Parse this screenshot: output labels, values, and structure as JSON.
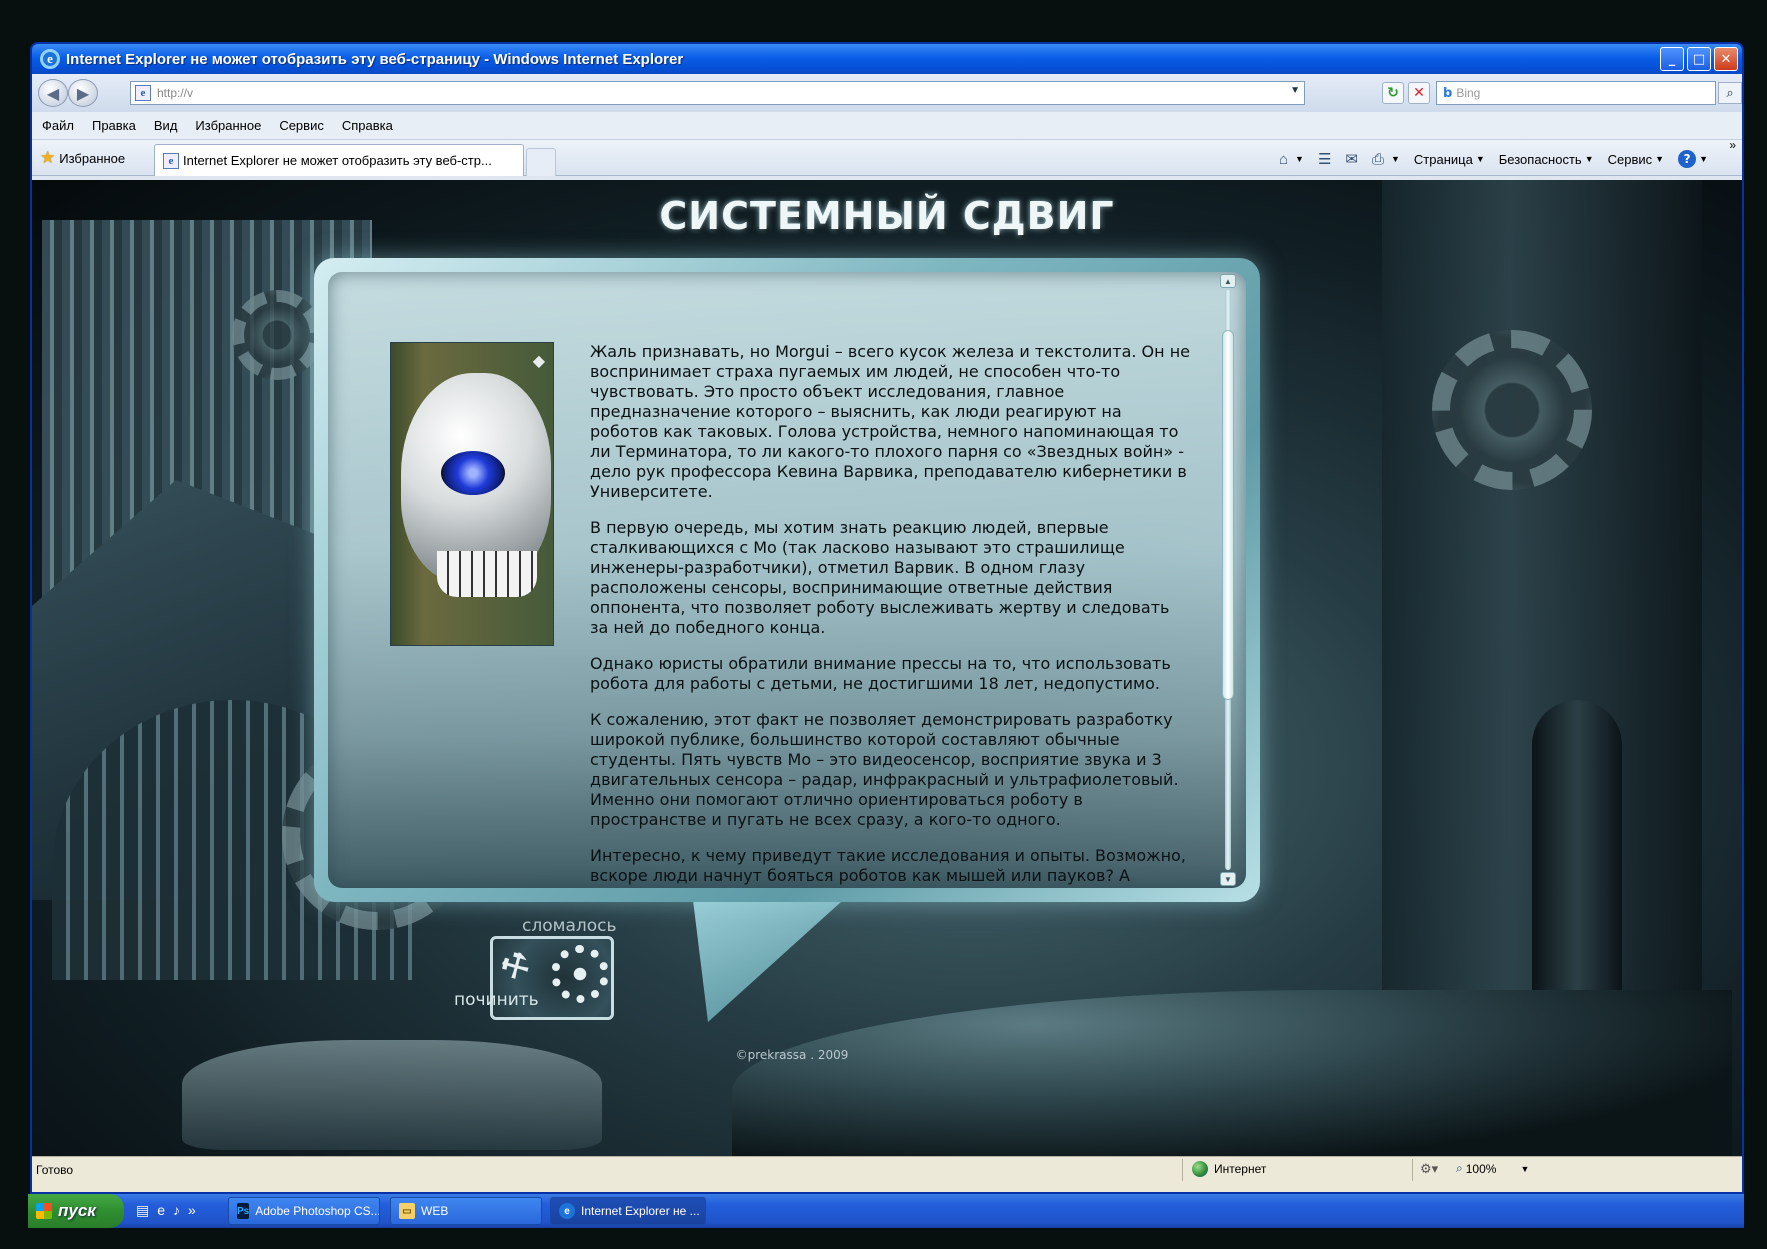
{
  "window": {
    "title": "Internet Explorer не может отобразить эту веб-страницу - Windows Internet Explorer",
    "controls": {
      "minimize": "_",
      "maximize": "□",
      "close": "✕"
    }
  },
  "toolbar": {
    "back": "◀",
    "forward": "▶",
    "address": "http://v",
    "refresh": "↻",
    "stop": "✕",
    "search_placeholder": "Bing",
    "search_btn": "⌕"
  },
  "menu": [
    "Файл",
    "Правка",
    "Вид",
    "Избранное",
    "Сервис",
    "Справка"
  ],
  "favbar": {
    "favorites": "Избранное",
    "tab_title": "Internet Explorer не может отобразить эту веб-стр...",
    "commands": {
      "page": "Страница",
      "security": "Безопасность",
      "service": "Сервис"
    }
  },
  "page": {
    "site_title": "СИСТЕМНЫЙ СДВИГ",
    "paragraphs": [
      "Жаль признавать, но Morgui – всего кусок железа и текстолита. Он не воспринимает страха пугаемых им людей, не способен что-то чувствовать. Это просто объект исследования, главное предназначение которого – выяснить, как люди реагируют на роботов как таковых. Голова устройства, немного напоминающая то ли Терминатора, то ли какого-то плохого парня со «Звездных войн» - дело рук профессора Кевина Варвика, преподавателю кибернетики в Университете.",
      "В первую очередь, мы хотим знать реакцию людей, впервые сталкивающихся с Мо (так ласково называют это страшилище инженеры-разработчики), отметил Варвик. В одном глазу расположены сенсоры, воспринимающие ответные действия оппонента, что позволяет роботу выслеживать жертву и следовать за ней до победного конца.",
      "Однако юристы обратили внимание прессы на то, что использовать робота для работы с детьми, не достигшими 18 лет, недопустимо.",
      "К сожалению, этот факт не позволяет демонстрировать разработку широкой публике, большинство которой составляют обычные студенты. Пять чувств Мо – это видеосенсор, восприятие звука и 3 двигательных сенсора – радар, инфракрасный и ультрафиолетовый. Именно они помогают отлично ориентироваться роботу в пространстве и пугать не всех сразу, а кого-то одного.",
      "Интересно, к чему приведут такие исследования и опыты. Возможно, вскоре люди начнут бояться роботов как мышей или пауков? А может, и нет. Поживем. увид"
    ],
    "fix_widget": {
      "top": "сломалось",
      "bottom": "починить"
    },
    "copyright": "©prekrassa . 2009"
  },
  "status": {
    "text": "Готово",
    "zone": "Интернет",
    "zoom": "100%"
  },
  "taskbar": {
    "start": "пуск",
    "tasks": [
      "Adobe Photoshop CS...",
      "WEB",
      "Internet Explorer не ..."
    ]
  }
}
